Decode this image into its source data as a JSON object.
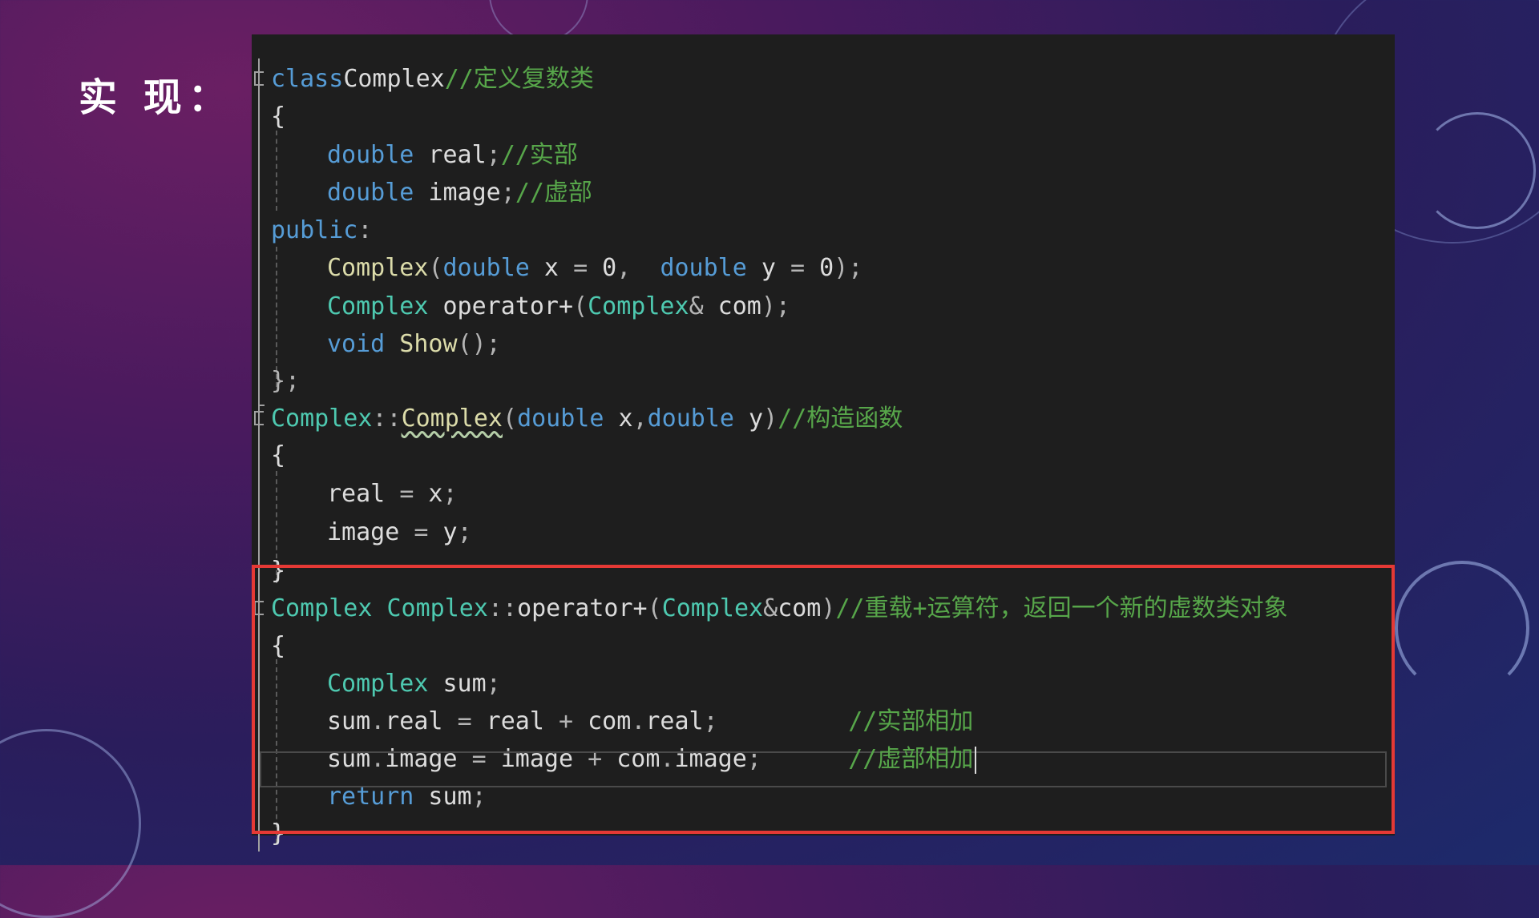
{
  "slide": {
    "title": "实 现："
  },
  "code": {
    "lines": [
      {
        "tokens": [
          [
            "kw",
            "class"
          ],
          [
            "",
            "Complex"
          ],
          [
            "cm",
            "//定义复数类"
          ]
        ]
      },
      {
        "tokens": [
          [
            "",
            "{"
          ]
        ]
      },
      {
        "tokens": [
          [
            "kw",
            "double"
          ],
          [
            "",
            " real"
          ],
          [
            "op",
            ";"
          ],
          [
            "cm",
            "//实部"
          ]
        ]
      },
      {
        "tokens": [
          [
            "kw",
            "double"
          ],
          [
            "",
            " image"
          ],
          [
            "op",
            ";"
          ],
          [
            "cm",
            "//虚部"
          ]
        ]
      },
      {
        "tokens": [
          [
            "kw",
            "public"
          ],
          [
            "op",
            ":"
          ]
        ]
      },
      {
        "tokens": [
          [
            "fn",
            "Complex"
          ],
          [
            "op",
            "("
          ],
          [
            "kw",
            "double"
          ],
          [
            "",
            " x "
          ],
          [
            "op",
            "="
          ],
          [
            "",
            " 0"
          ],
          [
            "op",
            ",  "
          ],
          [
            "kw",
            "double"
          ],
          [
            "",
            " y "
          ],
          [
            "op",
            "="
          ],
          [
            "",
            " 0"
          ],
          [
            "op",
            ");"
          ]
        ]
      },
      {
        "tokens": [
          [
            "ty",
            "Complex"
          ],
          [
            "",
            " operator+"
          ],
          [
            "op",
            "("
          ],
          [
            "ty",
            "Complex"
          ],
          [
            "op",
            "&"
          ],
          [
            "",
            " com"
          ],
          [
            "op",
            ");"
          ]
        ]
      },
      {
        "tokens": [
          [
            "kw",
            "void"
          ],
          [
            "fn",
            " Show"
          ],
          [
            "op",
            "();"
          ]
        ]
      },
      {
        "tokens": [
          [
            "op",
            "};"
          ]
        ]
      },
      {
        "tokens": [
          [
            "ty",
            "Complex"
          ],
          [
            "op",
            "::"
          ],
          [
            "fn",
            "Complex"
          ],
          [
            "op",
            "("
          ],
          [
            "kw",
            "double"
          ],
          [
            "",
            " x"
          ],
          [
            "op",
            ","
          ],
          [
            "kw",
            "double"
          ],
          [
            "",
            " y"
          ],
          [
            "op",
            ")"
          ],
          [
            "cm",
            "//构造函数"
          ]
        ]
      },
      {
        "tokens": [
          [
            "",
            "{"
          ]
        ]
      },
      {
        "tokens": [
          [
            "",
            "real "
          ],
          [
            "op",
            "="
          ],
          [
            "",
            " x"
          ],
          [
            "op",
            ";"
          ]
        ]
      },
      {
        "tokens": [
          [
            "",
            "image "
          ],
          [
            "op",
            "="
          ],
          [
            "",
            " y"
          ],
          [
            "op",
            ";"
          ]
        ]
      },
      {
        "tokens": [
          [
            "",
            "}"
          ]
        ]
      },
      {
        "tokens": [
          [
            "ty",
            "Complex"
          ],
          [
            "",
            " "
          ],
          [
            "ty",
            "Complex"
          ],
          [
            "op",
            "::"
          ],
          [
            "",
            "operator+"
          ],
          [
            "op",
            "("
          ],
          [
            "ty",
            "Complex"
          ],
          [
            "op",
            "&"
          ],
          [
            "",
            "com"
          ],
          [
            "op",
            ")"
          ],
          [
            "cm",
            "//重载+运算符，返回一个新的虚数类对象"
          ]
        ]
      },
      {
        "tokens": [
          [
            "",
            "{"
          ]
        ]
      },
      {
        "tokens": [
          [
            "ty",
            "Complex"
          ],
          [
            "",
            " sum"
          ],
          [
            "op",
            ";"
          ]
        ]
      },
      {
        "tokens": [
          [
            "",
            "sum"
          ],
          [
            "op",
            "."
          ],
          [
            "",
            "real "
          ],
          [
            "op",
            "="
          ],
          [
            "",
            " real "
          ],
          [
            "op",
            "+"
          ],
          [
            "",
            " com"
          ],
          [
            "op",
            "."
          ],
          [
            "",
            "real"
          ],
          [
            "op",
            ";"
          ],
          [
            "",
            "         "
          ],
          [
            "cm",
            "//实部相加"
          ]
        ]
      },
      {
        "tokens": [
          [
            "",
            "sum"
          ],
          [
            "op",
            "."
          ],
          [
            "",
            "image "
          ],
          [
            "op",
            "="
          ],
          [
            "",
            " image "
          ],
          [
            "op",
            "+"
          ],
          [
            "",
            " com"
          ],
          [
            "op",
            "."
          ],
          [
            "",
            "image"
          ],
          [
            "op",
            ";"
          ],
          [
            "",
            "      "
          ],
          [
            "cm",
            "//虚部相加"
          ]
        ]
      },
      {
        "tokens": [
          [
            "kw",
            "return"
          ],
          [
            "",
            " sum"
          ],
          [
            "op",
            ";"
          ]
        ]
      },
      {
        "tokens": [
          [
            "",
            "}"
          ]
        ]
      }
    ]
  },
  "colors": {
    "keyword": "#569cd6",
    "type": "#4ec9b0",
    "function": "#dcdcaa",
    "comment": "#57a64a",
    "highlight_border": "#e53935",
    "editor_bg": "#1e1e1e"
  }
}
